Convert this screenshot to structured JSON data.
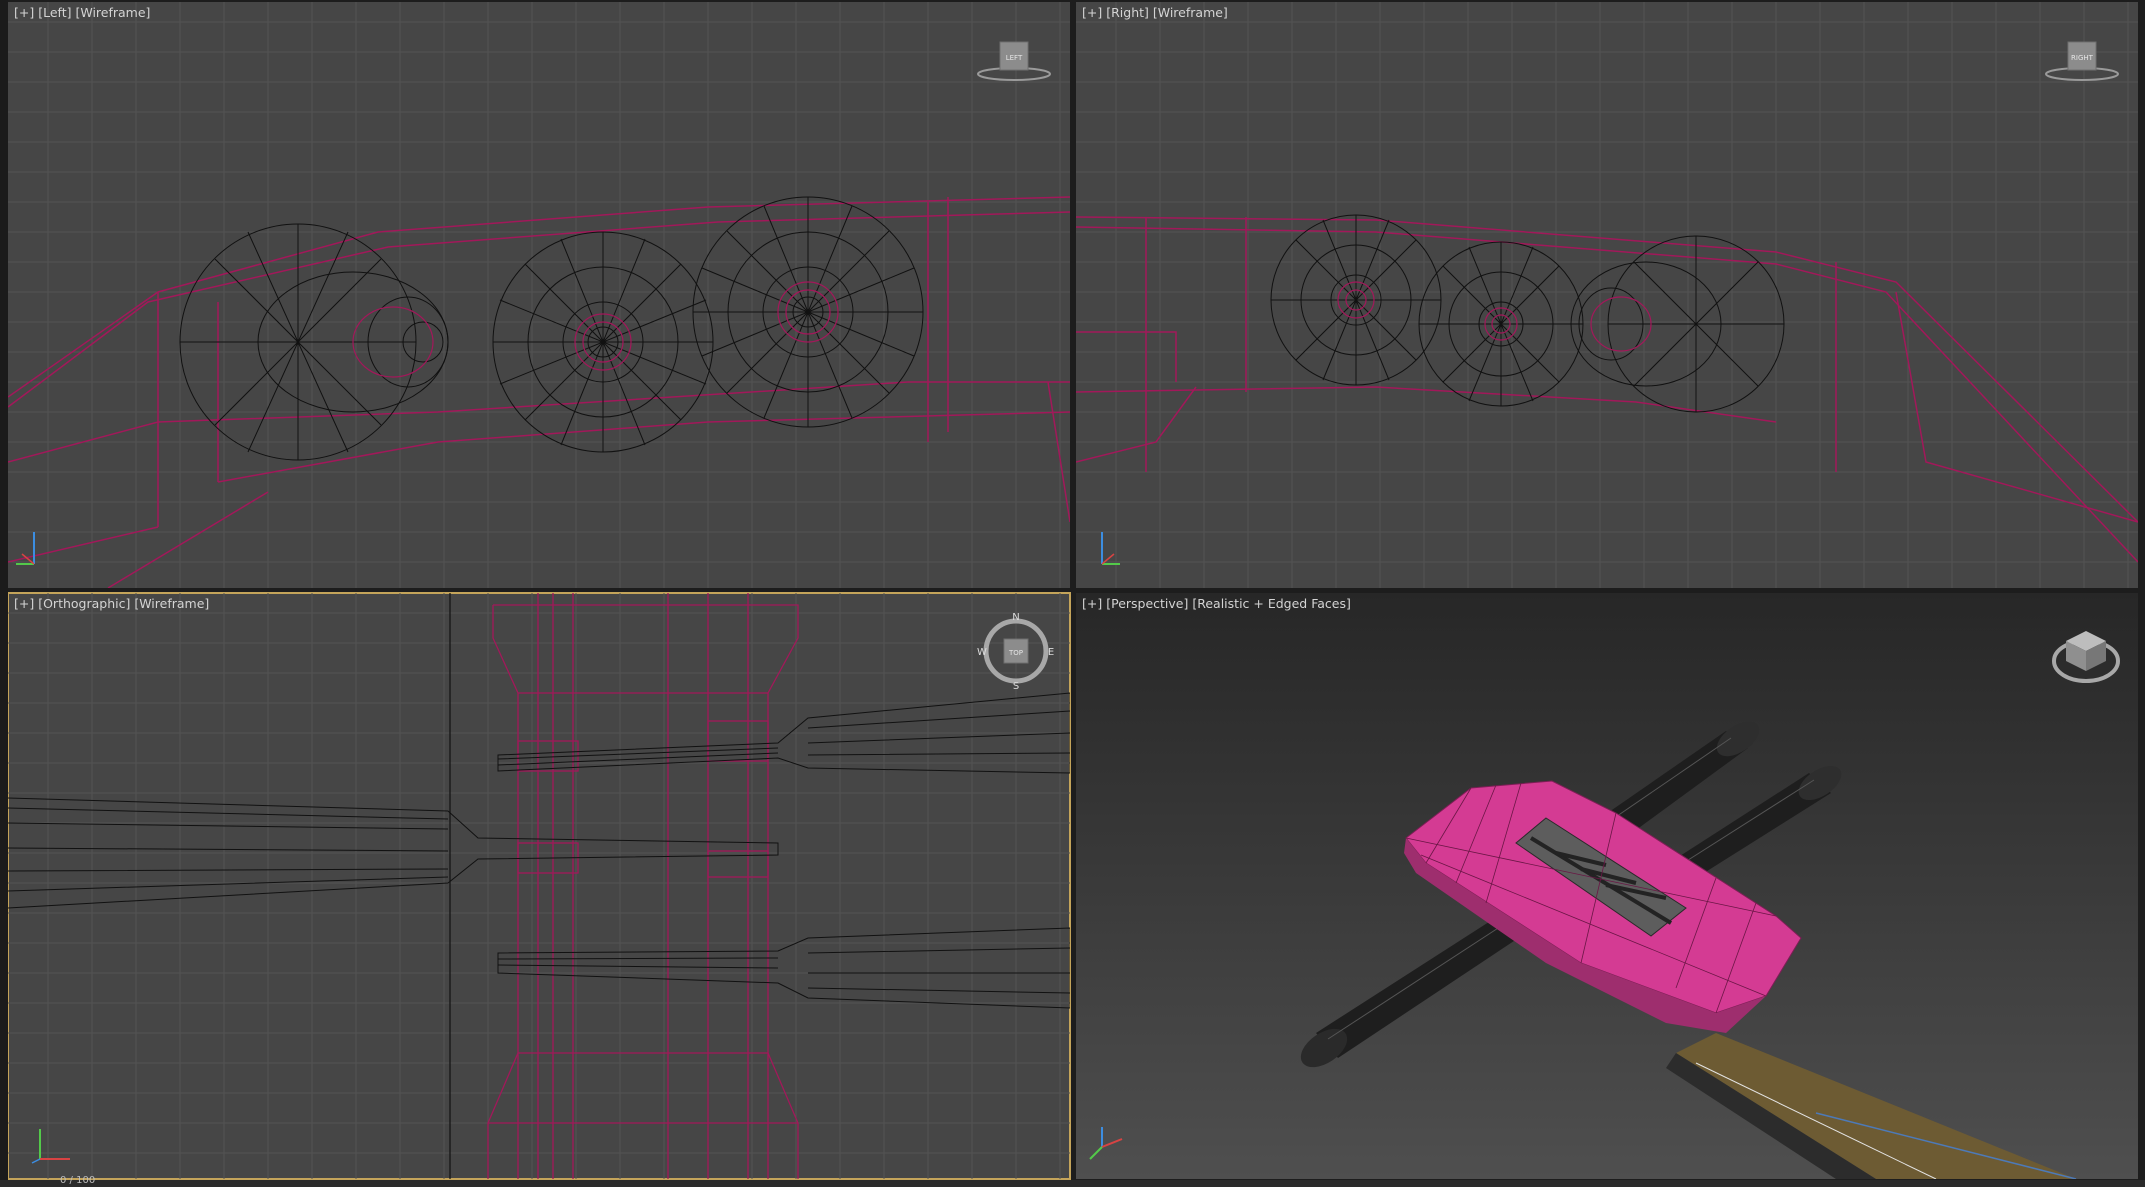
{
  "viewports": {
    "left": {
      "labels": [
        "[+]",
        "[Left]",
        "[Wireframe]"
      ],
      "cube_label": "LEFT"
    },
    "right": {
      "labels": [
        "[+]",
        "[Right]",
        "[Wireframe]"
      ],
      "cube_label": "RIGHT"
    },
    "ortho": {
      "labels": [
        "[+]",
        "[Orthographic]",
        "[Wireframe]"
      ],
      "cube_label": "TOP",
      "compass": {
        "n": "N",
        "s": "S",
        "e": "E",
        "w": "W"
      }
    },
    "persp": {
      "labels": [
        "[+]",
        "[Perspective]",
        "[Realistic + Edged Faces]"
      ]
    }
  },
  "status": {
    "frame": "0 / 100"
  },
  "colors": {
    "grid": "#545454",
    "wire_black": "#111111",
    "wire_magenta": "#a2185a",
    "active_border": "#c4a45a",
    "pink": "#d43b93",
    "wood": "#6d5b33"
  }
}
